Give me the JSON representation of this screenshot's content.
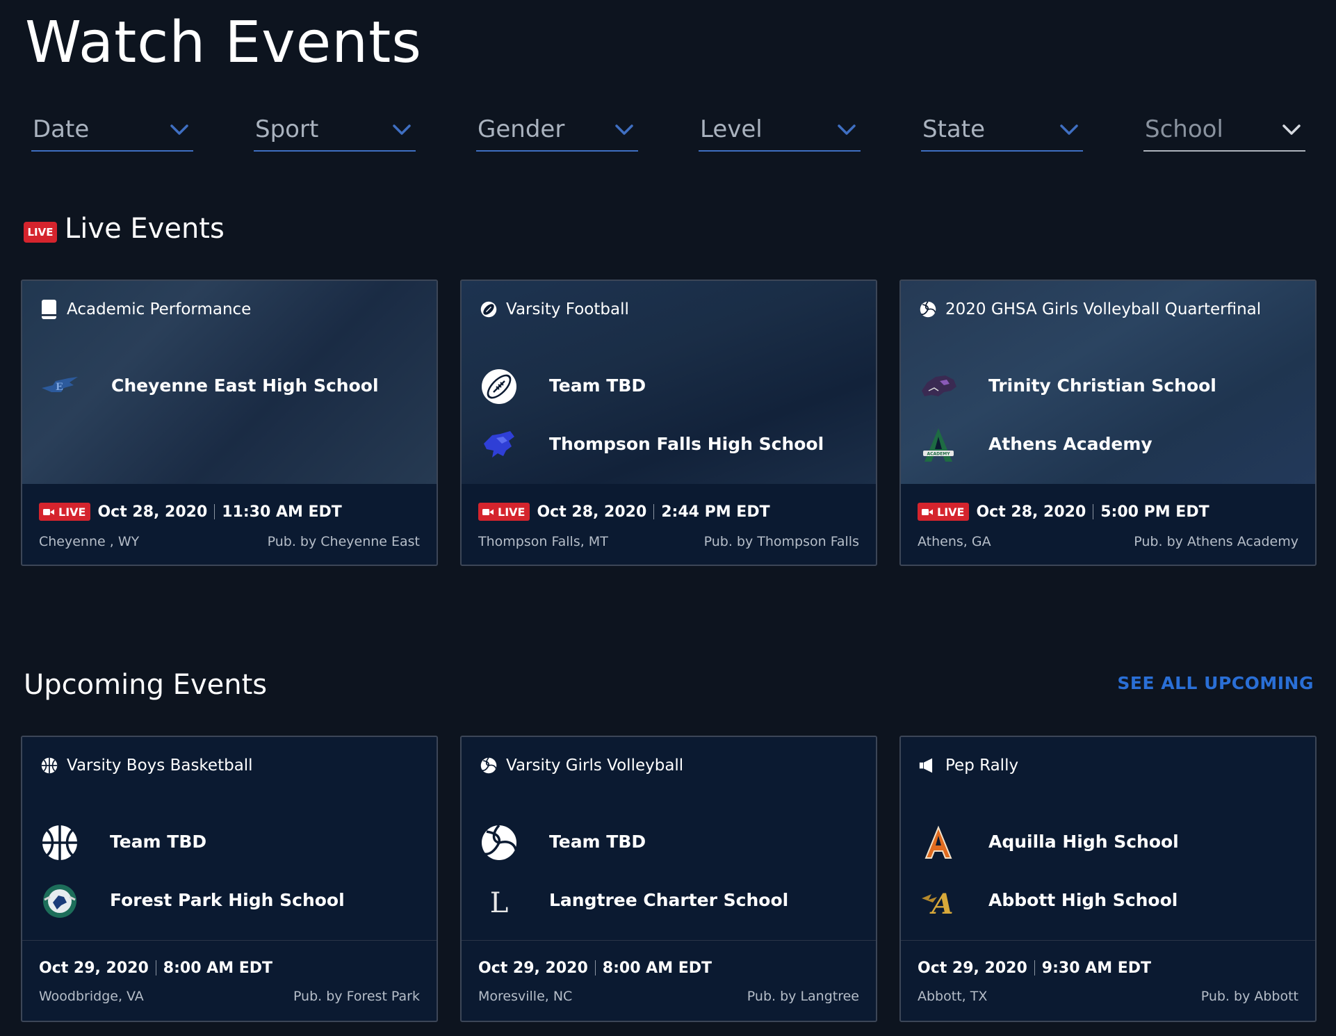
{
  "page": {
    "title": "Watch Events"
  },
  "filters": [
    {
      "label": "Date"
    },
    {
      "label": "Sport"
    },
    {
      "label": "Gender"
    },
    {
      "label": "Level"
    },
    {
      "label": "State"
    },
    {
      "label": "School"
    }
  ],
  "live": {
    "badge": "LIVE",
    "title": "Live Events",
    "cards": [
      {
        "event": "Academic Performance",
        "icon": "book-icon",
        "teams": [
          {
            "name": "Cheyenne East High School",
            "logo": "cheyenne-east-logo"
          }
        ],
        "live_label": "LIVE",
        "date": "Oct 28, 2020",
        "time": "11:30 AM EDT",
        "location": "Cheyenne , WY",
        "publisher": "Pub. by Cheyenne East"
      },
      {
        "event": "Varsity Football",
        "icon": "football-icon",
        "teams": [
          {
            "name": "Team TBD",
            "logo": "football-logo"
          },
          {
            "name": "Thompson Falls High School",
            "logo": "thompson-falls-logo"
          }
        ],
        "live_label": "LIVE",
        "date": "Oct 28, 2020",
        "time": "2:44 PM EDT",
        "location": "Thompson Falls, MT",
        "publisher": "Pub. by Thompson Falls"
      },
      {
        "event": "2020 GHSA Girls Volleyball Quarterfinal",
        "icon": "volleyball-icon",
        "teams": [
          {
            "name": "Trinity Christian School",
            "logo": "trinity-christian-logo"
          },
          {
            "name": "Athens Academy",
            "logo": "athens-academy-logo"
          }
        ],
        "live_label": "LIVE",
        "date": "Oct 28, 2020",
        "time": "5:00 PM EDT",
        "location": "Athens, GA",
        "publisher": "Pub. by Athens Academy"
      }
    ]
  },
  "upcoming": {
    "title": "Upcoming Events",
    "see_all": "SEE ALL UPCOMING",
    "cards": [
      {
        "event": "Varsity Boys Basketball",
        "icon": "basketball-icon",
        "teams": [
          {
            "name": "Team TBD",
            "logo": "basketball-logo"
          },
          {
            "name": "Forest Park High School",
            "logo": "forest-park-logo"
          }
        ],
        "date": "Oct 29, 2020",
        "time": "8:00 AM EDT",
        "location": "Woodbridge, VA",
        "publisher": "Pub. by Forest Park"
      },
      {
        "event": "Varsity Girls Volleyball",
        "icon": "volleyball-icon",
        "teams": [
          {
            "name": "Team TBD",
            "logo": "volleyball-logo"
          },
          {
            "name": "Langtree Charter School",
            "logo": "langtree-logo"
          }
        ],
        "date": "Oct 29, 2020",
        "time": "8:00 AM EDT",
        "location": "Moresville, NC",
        "publisher": "Pub. by Langtree"
      },
      {
        "event": "Pep Rally",
        "icon": "megaphone-icon",
        "teams": [
          {
            "name": "Aquilla High School",
            "logo": "aquilla-logo"
          },
          {
            "name": "Abbott High School",
            "logo": "abbott-logo"
          }
        ],
        "date": "Oct 29, 2020",
        "time": "9:30 AM EDT",
        "location": "Abbott, TX",
        "publisher": "Pub. by Abbott"
      }
    ]
  },
  "colors": {
    "background": "#0d141f",
    "card": "#0b1a31",
    "accent": "#2a6fd6",
    "live": "#d5242d",
    "filter_underline": "#3f6fc2"
  }
}
